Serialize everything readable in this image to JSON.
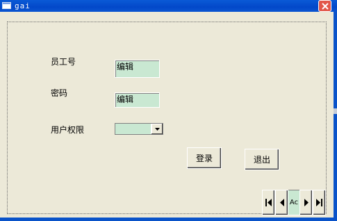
{
  "window": {
    "title": "gai"
  },
  "form": {
    "employee_id_label": "员工号",
    "employee_id_value": "编辑",
    "password_label": "密码",
    "password_value": "编辑",
    "permission_label": "用户权限",
    "permission_value": "",
    "login_button": "登录",
    "exit_button": "退出"
  },
  "navigator": {
    "record_text": "Ac"
  },
  "colors": {
    "titlebar": "#0a5ad6",
    "field_bg": "#c9e8d2",
    "window_bg": "#ece9d8"
  },
  "icons": [
    "window-icon",
    "close-icon",
    "dropdown-arrow-icon",
    "first-record-icon",
    "prev-record-icon",
    "next-record-icon",
    "last-record-icon"
  ]
}
